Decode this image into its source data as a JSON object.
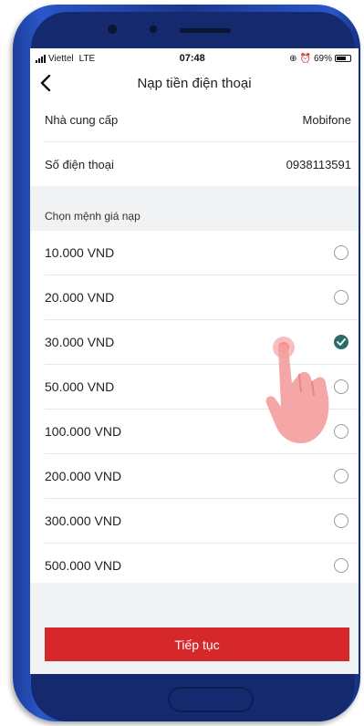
{
  "status_bar": {
    "carrier": "Viettel",
    "network": "LTE",
    "time": "07:48",
    "battery_percent": "69%",
    "battery_level": 0.69
  },
  "nav": {
    "title": "Nạp tiền điện thoại"
  },
  "info": {
    "provider_label": "Nhà cung cấp",
    "provider_value": "Mobifone",
    "phone_label": "Số điện thoại",
    "phone_value": "0938113591"
  },
  "denominations": {
    "header": "Chọn mệnh giá nạp",
    "options": [
      {
        "label": "10.000 VND",
        "selected": false
      },
      {
        "label": "20.000 VND",
        "selected": false
      },
      {
        "label": "30.000 VND",
        "selected": true
      },
      {
        "label": "50.000 VND",
        "selected": false
      },
      {
        "label": "100.000 VND",
        "selected": false
      },
      {
        "label": "200.000 VND",
        "selected": false
      },
      {
        "label": "300.000 VND",
        "selected": false
      },
      {
        "label": "500.000 VND",
        "selected": false
      }
    ]
  },
  "footer": {
    "continue_label": "Tiếp tục"
  },
  "colors": {
    "accent_red": "#d6282a",
    "selected_radio": "#2d6b6b",
    "phone_frame": "#1f45b0",
    "section_bg": "#f1f2f4"
  },
  "icons": [
    "back-chevron-icon",
    "signal-icon",
    "alarm-icon",
    "battery-icon",
    "check-icon",
    "hand-pointer-icon"
  ]
}
